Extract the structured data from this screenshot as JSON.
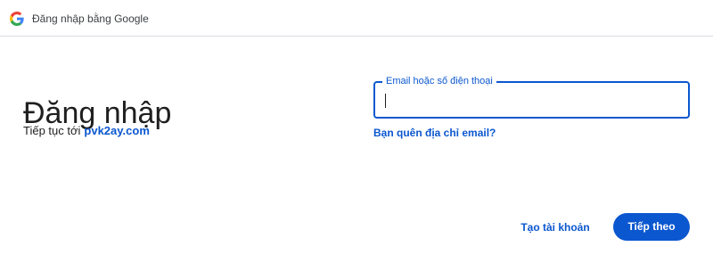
{
  "header": {
    "title": "Đăng nhập bằng Google",
    "logo_icon": "google-g-icon"
  },
  "main": {
    "heading": "Đăng nhập",
    "continue_prefix": "Tiếp tục tới",
    "continue_site": "pvk2ay.com"
  },
  "email_field": {
    "label": "Email hoặc số điện thoại",
    "value": ""
  },
  "links": {
    "forgot_email": "Bạn quên địa chỉ email?",
    "create_account": "Tạo tài khoản"
  },
  "actions": {
    "next_label": "Tiếp theo"
  },
  "colors": {
    "accent": "#0b57d0",
    "text": "#1f1f1f",
    "divider": "#dadce0"
  }
}
